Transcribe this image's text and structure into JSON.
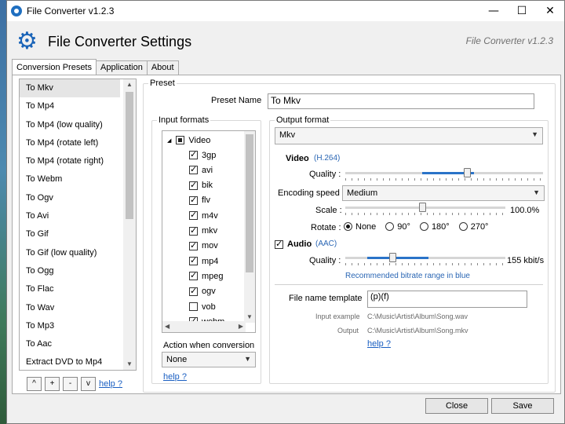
{
  "window": {
    "title": "File Converter v1.2.3",
    "minimize": "—",
    "maximize": "☐",
    "close": "✕"
  },
  "header": {
    "title": "File Converter Settings",
    "version": "File Converter v1.2.3"
  },
  "tabs": [
    {
      "label": "Conversion Presets",
      "active": true
    },
    {
      "label": "Application",
      "active": false
    },
    {
      "label": "About",
      "active": false
    }
  ],
  "presets": {
    "items": [
      "To Mkv",
      "To Mp4",
      "To Mp4 (low quality)",
      "To Mp4 (rotate left)",
      "To Mp4 (rotate right)",
      "To Webm",
      "To Ogv",
      "To Avi",
      "To Gif",
      "To Gif (low quality)",
      "To Ogg",
      "To Flac",
      "To Wav",
      "To Mp3",
      "To Aac",
      "Extract DVD to Mp4"
    ],
    "selected_index": 0,
    "buttons": {
      "up": "^",
      "add": "+",
      "remove": "-",
      "down": "v"
    },
    "help": "help ?"
  },
  "preset_group": {
    "legend": "Preset",
    "name_label": "Preset Name",
    "name_value": "To Mkv"
  },
  "input_formats": {
    "legend": "Input formats",
    "root_label": "Video",
    "root_toggle": "◢",
    "items": [
      {
        "label": "3gp",
        "checked": true
      },
      {
        "label": "avi",
        "checked": true
      },
      {
        "label": "bik",
        "checked": true
      },
      {
        "label": "flv",
        "checked": true
      },
      {
        "label": "m4v",
        "checked": true
      },
      {
        "label": "mkv",
        "checked": true
      },
      {
        "label": "mov",
        "checked": true
      },
      {
        "label": "mp4",
        "checked": true
      },
      {
        "label": "mpeg",
        "checked": true
      },
      {
        "label": "ogv",
        "checked": true
      },
      {
        "label": "vob",
        "checked": false
      },
      {
        "label": "webm",
        "checked": true
      }
    ],
    "action_label": "Action when conversion",
    "action_value": "None",
    "help": "help ?"
  },
  "output_format": {
    "legend": "Output format",
    "format_value": "Mkv",
    "video": {
      "label": "Video",
      "codec": "(H.264)",
      "quality_label": "Quality :",
      "quality_value": 0.62,
      "encoding_label": "Encoding speed :",
      "encoding_value": "Medium",
      "scale_label": "Scale :",
      "scale_value": "100.0%",
      "rotate_label": "Rotate :",
      "rotate_options": [
        "None",
        "90°",
        "180°",
        "270°"
      ],
      "rotate_selected": 0
    },
    "audio": {
      "label": "Audio",
      "codec": "(AAC)",
      "quality_label": "Quality :",
      "quality_value": "155 kbit/s",
      "recommended": "Recommended bitrate range in blue"
    },
    "template": {
      "label": "File name template",
      "value": "(p)(f)",
      "input_example_label": "Input example",
      "input_example_value": "C:\\Music\\Artist\\Album\\Song.wav",
      "output_label": "Output",
      "output_value": "C:\\Music\\Artist\\Album\\Song.mkv",
      "help": "help ?"
    }
  },
  "footer": {
    "close": "Close",
    "save": "Save"
  },
  "colors": {
    "accent": "#2a73c8",
    "link": "#1a5fc2"
  },
  "icons": {
    "app": "file-converter-icon",
    "header": "gear-icon"
  }
}
